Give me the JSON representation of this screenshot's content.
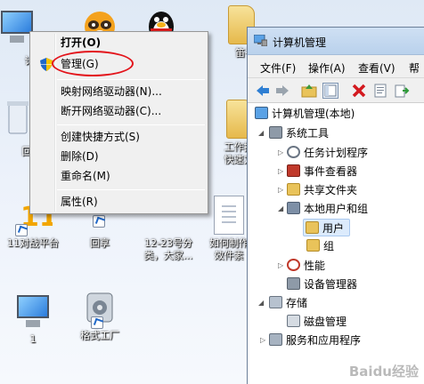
{
  "desktop": {
    "icons": [
      {
        "label": "计"
      },
      {
        "label": ""
      },
      {
        "label": ""
      },
      {
        "label": "笛子"
      },
      {
        "label": "回"
      },
      {
        "label": "工作指"
      },
      {
        "label": "快速方"
      },
      {
        "label": "11对战平台"
      },
      {
        "label": "回享"
      },
      {
        "label": "12-23号分"
      },
      {
        "label": "类，大家..."
      },
      {
        "label": "如何制作"
      },
      {
        "label": "效件素"
      },
      {
        "label": "1"
      },
      {
        "label": "格式工厂"
      }
    ]
  },
  "context_menu": {
    "items": [
      {
        "label": "打开(O)",
        "bold": true
      },
      {
        "label": "管理(G)"
      },
      {
        "label": "映射网络驱动器(N)..."
      },
      {
        "label": "断开网络驱动器(C)..."
      },
      {
        "label": "创建快捷方式(S)"
      },
      {
        "label": "删除(D)"
      },
      {
        "label": "重命名(M)"
      },
      {
        "label": "属性(R)"
      }
    ]
  },
  "window": {
    "title": "计算机管理",
    "menu": [
      "文件(F)",
      "操作(A)",
      "查看(V)",
      "帮"
    ],
    "tree": [
      {
        "label": "计算机管理(本地)"
      },
      {
        "label": "系统工具"
      },
      {
        "label": "任务计划程序"
      },
      {
        "label": "事件查看器"
      },
      {
        "label": "共享文件夹"
      },
      {
        "label": "本地用户和组"
      },
      {
        "label": "用户"
      },
      {
        "label": "组"
      },
      {
        "label": "性能"
      },
      {
        "label": "设备管理器"
      },
      {
        "label": "存储"
      },
      {
        "label": "磁盘管理"
      },
      {
        "label": "服务和应用程序"
      }
    ]
  },
  "watermark": "Baidu经验",
  "colors": {
    "accent": "#e3141b",
    "selection": "#dcebfc"
  }
}
